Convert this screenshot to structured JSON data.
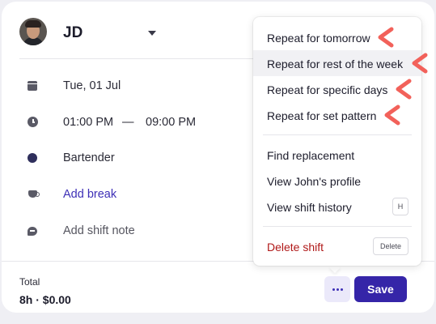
{
  "header": {
    "name": "JD"
  },
  "details": {
    "date": "Tue, 01 Jul",
    "start_time": "01:00 PM",
    "time_separator": "—",
    "end_time": "09:00 PM",
    "role": "Bartender",
    "add_break": "Add break",
    "add_note": "Add shift note"
  },
  "footer": {
    "total_label": "Total",
    "total_value": "8h · $0.00",
    "save_label": "Save"
  },
  "menu": {
    "repeat_items": [
      "Repeat for tomorrow",
      "Repeat for rest of the week",
      "Repeat for specific days",
      "Repeat for set pattern"
    ],
    "find_replacement": "Find replacement",
    "view_profile": "View John's profile",
    "view_history": "View shift history",
    "view_history_shortcut": "H",
    "delete_shift": "Delete shift",
    "delete_shortcut": "Delete"
  },
  "colors": {
    "accent": "#3525a8",
    "danger": "#b01818",
    "annotation_arrow": "#f2615a"
  }
}
